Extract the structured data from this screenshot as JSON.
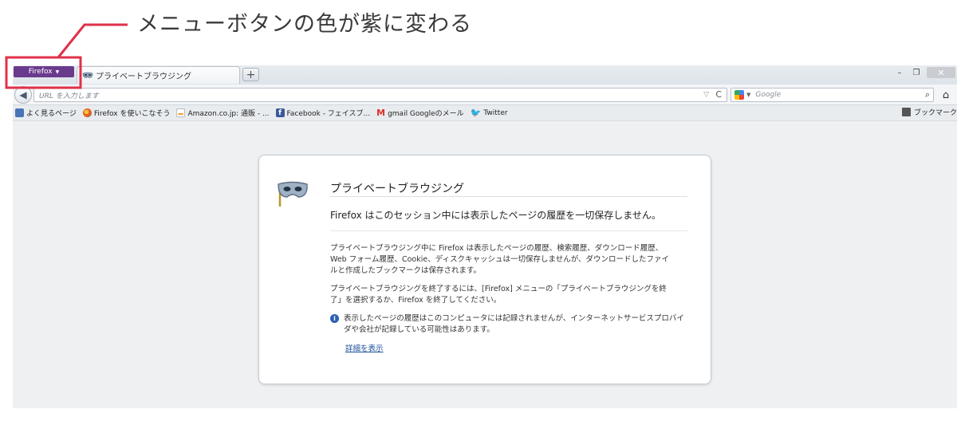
{
  "annotation": {
    "caption": "メニューボタンの色が紫に変わる",
    "highlight_color": "#e0304a"
  },
  "titlebar": {
    "menu_button_label": "Firefox",
    "menu_button_color": "#6a3a8d",
    "tab_title": "プライベートブラウジング",
    "new_tab_label": "+",
    "minimize_label": "–",
    "maximize_label": "❐",
    "close_label": "✕"
  },
  "navbar": {
    "back_label": "◀",
    "url_placeholder": "URL を入力します",
    "reload_label": "C",
    "search_placeholder": "Google",
    "search_engine_icon": "google-icon",
    "search_button_label": "⌕",
    "home_label": "⌂"
  },
  "bookmarks": {
    "items": [
      {
        "label": "よく見るページ",
        "icon": "most-visited-icon"
      },
      {
        "label": "Firefox を使いこなそう",
        "icon": "firefox-icon"
      },
      {
        "label": "Amazon.co.jp: 通販 - ...",
        "icon": "amazon-icon"
      },
      {
        "label": "Facebook - フェイスブ...",
        "icon": "facebook-icon"
      },
      {
        "label": "gmail Googleのメール",
        "icon": "gmail-icon"
      },
      {
        "label": "Twitter",
        "icon": "twitter-icon"
      }
    ],
    "menu_label": "ブックマーク"
  },
  "page": {
    "title": "プライベートブラウジング",
    "subtitle": "Firefox はこのセッション中には表示したページの履歴を一切保存しません。",
    "body1": "プライベートブラウジング中に Firefox は表示したページの履歴、検索履歴、ダウンロード履歴、Web フォーム履歴、Cookie、ディスクキャッシュは一切保存しませんが、ダウンロードしたファイルと作成したブックマークは保存されます。",
    "body2": "プライベートブラウジングを終了するには、[Firefox] メニューの「プライベートブラウジングを終了」を選択するか、Firefox を終了してください。",
    "info": "表示したページの履歴はこのコンピュータには記録されませんが、インターネットサービスプロバイダや会社が記録している可能性はあります。",
    "more_link": "詳細を表示"
  }
}
